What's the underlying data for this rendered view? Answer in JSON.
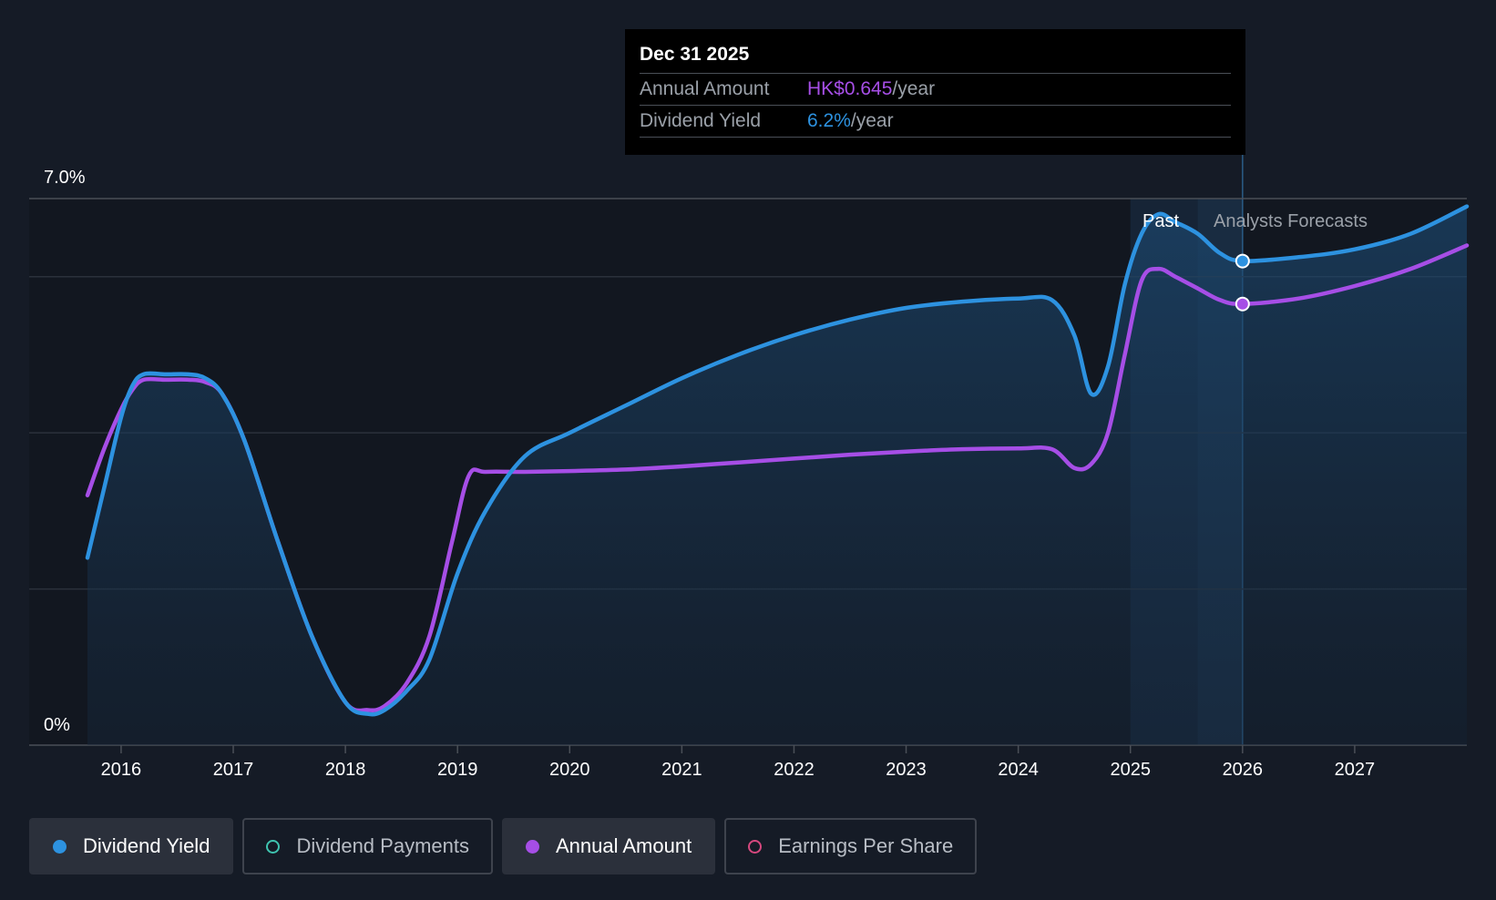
{
  "tooltip": {
    "date": "Dec 31 2025",
    "rows": [
      {
        "key": "Annual Amount",
        "value": "HK$0.645",
        "unit": "/year",
        "color": "#a64ee6"
      },
      {
        "key": "Dividend Yield",
        "value": "6.2%",
        "unit": "/year",
        "color": "#2d92e0"
      }
    ]
  },
  "regions": {
    "past": "Past",
    "forecast": "Analysts Forecasts"
  },
  "legend": [
    {
      "label": "Dividend Yield",
      "color": "#2d92e0",
      "active": true,
      "filled": true
    },
    {
      "label": "Dividend Payments",
      "color": "#3fc4b0",
      "active": false,
      "filled": false
    },
    {
      "label": "Annual Amount",
      "color": "#a64ee6",
      "active": true,
      "filled": true
    },
    {
      "label": "Earnings Per Share",
      "color": "#d6487e",
      "active": false,
      "filled": false
    }
  ],
  "chart_data": {
    "type": "line",
    "y_tick_labels": [
      "7.0%",
      "0%"
    ],
    "ylim": [
      0,
      7.0
    ],
    "x_ticks": [
      2016,
      2017,
      2018,
      2019,
      2020,
      2021,
      2022,
      2023,
      2024,
      2025,
      2026,
      2027
    ],
    "xlim": [
      2015.7,
      2028.0
    ],
    "grid": true,
    "past_forecast_boundary": 2025.6,
    "marker_x": 2026.0,
    "series": [
      {
        "name": "Dividend Yield",
        "color": "#2d92e0",
        "x": [
          2015.7,
          2015.85,
          2016.0,
          2016.1,
          2016.2,
          2016.4,
          2016.6,
          2016.75,
          2016.9,
          2017.1,
          2017.4,
          2017.7,
          2018.0,
          2018.2,
          2018.35,
          2018.55,
          2018.75,
          2019.0,
          2019.25,
          2019.6,
          2020.0,
          2020.5,
          2021.0,
          2021.5,
          2022.0,
          2022.5,
          2023.0,
          2023.5,
          2024.0,
          2024.3,
          2024.5,
          2024.65,
          2024.8,
          2024.95,
          2025.1,
          2025.25,
          2025.4,
          2025.6,
          2025.8,
          2026.0,
          2026.5,
          2027.0,
          2027.5,
          2028.0
        ],
        "values": [
          2.4,
          3.3,
          4.2,
          4.6,
          4.75,
          4.75,
          4.75,
          4.7,
          4.5,
          3.9,
          2.6,
          1.4,
          0.55,
          0.4,
          0.45,
          0.7,
          1.1,
          2.2,
          3.0,
          3.7,
          4.0,
          4.35,
          4.7,
          5.0,
          5.25,
          5.45,
          5.6,
          5.68,
          5.72,
          5.7,
          5.25,
          4.5,
          4.85,
          5.9,
          6.55,
          6.8,
          6.7,
          6.55,
          6.3,
          6.2,
          6.25,
          6.35,
          6.55,
          6.9
        ]
      },
      {
        "name": "Annual Amount",
        "color": "#a64ee6",
        "x": [
          2015.7,
          2015.85,
          2016.0,
          2016.1,
          2016.2,
          2016.4,
          2016.6,
          2016.75,
          2016.9,
          2017.1,
          2017.4,
          2017.7,
          2018.0,
          2018.2,
          2018.35,
          2018.55,
          2018.75,
          2018.95,
          2019.1,
          2019.25,
          2019.6,
          2020.0,
          2020.5,
          2021.0,
          2021.5,
          2022.0,
          2022.5,
          2023.0,
          2023.5,
          2024.0,
          2024.3,
          2024.5,
          2024.65,
          2024.8,
          2024.95,
          2025.1,
          2025.25,
          2025.4,
          2025.6,
          2025.8,
          2026.0,
          2026.5,
          2027.0,
          2027.5,
          2028.0
        ],
        "values": [
          3.2,
          3.8,
          4.3,
          4.55,
          4.68,
          4.68,
          4.68,
          4.65,
          4.5,
          3.9,
          2.6,
          1.4,
          0.55,
          0.45,
          0.5,
          0.8,
          1.4,
          2.6,
          3.45,
          3.5,
          3.5,
          3.51,
          3.53,
          3.57,
          3.62,
          3.67,
          3.72,
          3.76,
          3.79,
          3.8,
          3.79,
          3.55,
          3.6,
          4.0,
          5.0,
          5.95,
          6.1,
          6.0,
          5.85,
          5.7,
          5.65,
          5.72,
          5.88,
          6.1,
          6.4
        ]
      }
    ]
  }
}
